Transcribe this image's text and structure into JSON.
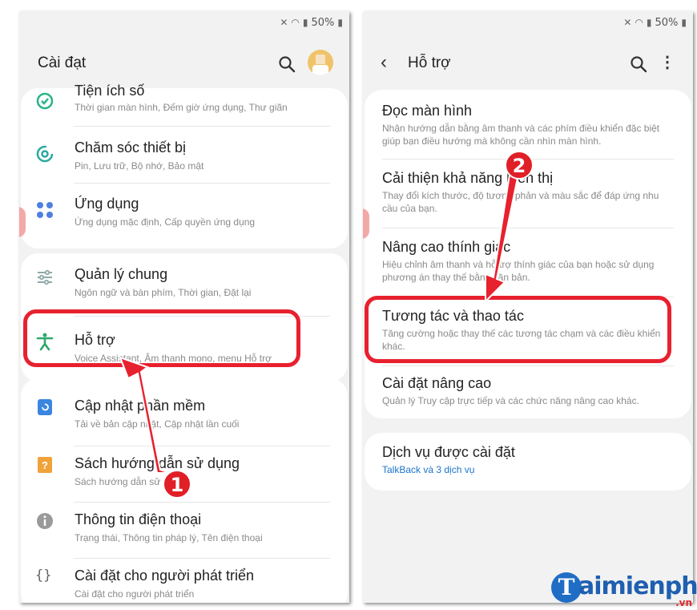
{
  "status_bar": {
    "battery": "50%"
  },
  "left": {
    "title": "Cài đạt",
    "items": [
      {
        "title": "Tiện ích số",
        "subtitle": "Thời gian màn hình, Đếm giờ ứng dụng, Thư giãn",
        "icon": "digital-wellbeing-icon"
      },
      {
        "title": "Chăm sóc thiết bị",
        "subtitle": "Pin, Lưu trữ, Bộ nhớ, Bảo mật",
        "icon": "device-care-icon"
      },
      {
        "title": "Ứng dụng",
        "subtitle": "Ứng dụng mặc định, Cấp quyền ứng dụng",
        "icon": "apps-icon"
      },
      {
        "title": "Quản lý chung",
        "subtitle": "Ngôn ngữ và bàn phím, Thời gian, Đặt lại",
        "icon": "general-management-icon"
      },
      {
        "title": "Hỗ trợ",
        "subtitle": "Voice Assistant, Âm thanh mono, menu Hỗ trợ",
        "icon": "accessibility-icon"
      },
      {
        "title": "Cập nhật phần mềm",
        "subtitle": "Tải về bản cập nhật, Cập nhật lần cuối",
        "icon": "software-update-icon"
      },
      {
        "title": "Sách hướng dẫn sử dụng",
        "subtitle": "Sách hướng dẫn sử dụng",
        "icon": "user-manual-icon"
      },
      {
        "title": "Thông tin điện thoại",
        "subtitle": "Trạng thái, Thông tin pháp lý, Tên điện thoại",
        "icon": "info-icon"
      },
      {
        "title": "Cài đặt cho người phát triển",
        "subtitle": "Cài đặt cho người phát triển",
        "icon": "developer-options-icon"
      }
    ]
  },
  "right": {
    "title": "Hỗ trợ",
    "items": [
      {
        "title": "Đọc màn hình",
        "subtitle": "Nhận hướng dẫn bằng âm thanh và các phím điều khiển đặc biệt giúp bạn điều hướng mà không cần nhìn màn hình."
      },
      {
        "title": "Cải thiện khả năng hiển thị",
        "subtitle": "Thay đổi kích thước, độ tương phản và màu sắc để đáp ứng nhu cầu của bạn."
      },
      {
        "title": "Nâng cao thính giác",
        "subtitle": "Hiệu chỉnh âm thanh và hỗ trợ thính giác của bạn hoặc sử dụng phương án thay thế bằng văn bản."
      },
      {
        "title": "Tương tác và thao tác",
        "subtitle": "Tăng cường hoặc thay thế các tương tác chạm và các điều khiển khác."
      },
      {
        "title": "Cài đặt nâng cao",
        "subtitle": "Quản lý Truy cập trực tiếp và các chức năng nâng cao khác."
      },
      {
        "title": "Dịch vụ được cài đặt",
        "subtitle": "TalkBack và 3 dịch vụ"
      }
    ]
  },
  "annotations": {
    "step1": "1",
    "step2": "2"
  },
  "watermark": {
    "brand": "aimienphi",
    "brand_initial": "T",
    "tld": ".vn"
  },
  "colors": {
    "highlight": "#e8212e",
    "link": "#1a73c9",
    "brand": "#1f5fb0"
  }
}
